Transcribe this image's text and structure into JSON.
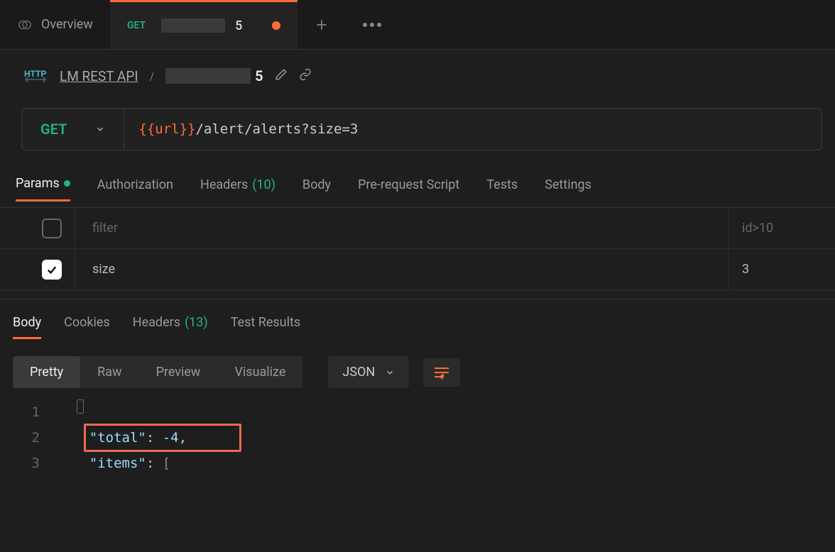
{
  "tabs": {
    "overview": "Overview",
    "active": {
      "method": "GET",
      "suffix": "5"
    }
  },
  "breadcrumb": {
    "http_badge": "HTTP",
    "workspace": "LM REST API",
    "suffix": "5"
  },
  "request": {
    "method": "GET",
    "url_var": "{{url}}",
    "url_path": "/alert/alerts?size=3"
  },
  "req_tabs": {
    "params": "Params",
    "authorization": "Authorization",
    "headers": "Headers",
    "headers_count": "(10)",
    "body": "Body",
    "prerequest": "Pre-request Script",
    "tests": "Tests",
    "settings": "Settings"
  },
  "params": [
    {
      "checked": false,
      "key": "filter",
      "key_placeholder": true,
      "value": "id>10",
      "value_placeholder": true
    },
    {
      "checked": true,
      "key": "size",
      "key_placeholder": false,
      "value": "3",
      "value_placeholder": false
    }
  ],
  "resp_tabs": {
    "body": "Body",
    "cookies": "Cookies",
    "headers": "Headers",
    "headers_count": "(13)",
    "test_results": "Test Results"
  },
  "view_tabs": {
    "pretty": "Pretty",
    "raw": "Raw",
    "preview": "Preview",
    "visualize": "Visualize"
  },
  "format": "JSON",
  "code": {
    "l1_num": "1",
    "l1_text": "{",
    "l2_num": "2",
    "l2_key": "\"total\"",
    "l2_val": "-4",
    "l3_num": "3",
    "l3_key": "\"items\"",
    "l3_val": "["
  }
}
